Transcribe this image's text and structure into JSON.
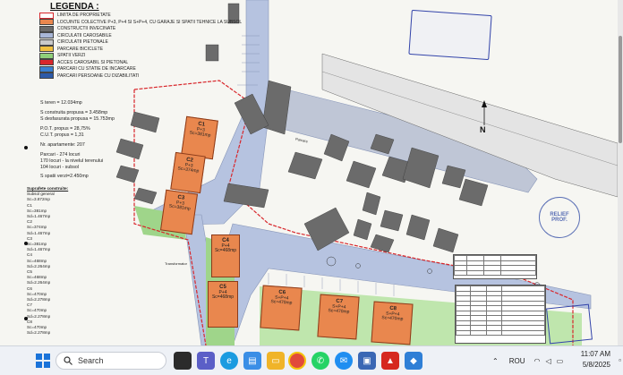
{
  "legend": {
    "title": "LEGENDA :",
    "items": [
      {
        "label": "LIMITA DE PROPRIETATE",
        "color": "#ffffff",
        "border": "#d8262b"
      },
      {
        "label": "LOCUINTE COLECTIVE P+3, P+4 SI S+P+4, CU GARAJE SI SPATII TEHNICE LA SUBSOL",
        "color": "#e9874e"
      },
      {
        "label": "CONSTRUCTII INVECINATE",
        "color": "#6b6b6b"
      },
      {
        "label": "CIRCULATII CAROSABILE",
        "color": "#a8b6d6"
      },
      {
        "label": "CIRCULATII PIETONALE",
        "color": "#c9c9c9"
      },
      {
        "label": "PARCARE BICICLETE",
        "color": "#f0c040"
      },
      {
        "label": "SPATII VERZI",
        "color": "#8fcf7a"
      },
      {
        "label": "ACCES CAROSABIL SI PIETONAL",
        "color": "#d8262b"
      },
      {
        "label": "PARCARI CU STATIE DE INCARCARE",
        "color": "#3a7fd0"
      },
      {
        "label": "PARCARI PERSOANE CU DIZABILITATI",
        "color": "#2d5aa8"
      }
    ]
  },
  "stats": {
    "teren": "S teren = 12.034mp",
    "construita": "S construita propusa = 3.458mp",
    "desfasurata": "S desfasurata propusa = 15.753mp",
    "pot": "P.O.T. propus = 28,75%",
    "cut": "C.U.T. propus = 1,31",
    "apartamente": "Nr. apartamente: 207",
    "parcari": "Parcari - 274 locuri",
    "parcari_teren": "170 locuri - la nivelul terenului",
    "parcari_subsol": "104 locuri - subsol",
    "spatii_verzi": "S spatii verzi=2.450mp"
  },
  "surfaces": {
    "title": "Suprafete construite:",
    "lines": [
      "Subsol general",
      "Sc=3.872mp",
      "C1",
      "Sc=381mp",
      "Sd=1.467mp",
      "C2",
      "Sc=374mp",
      "Sd=1.467mp",
      "C3",
      "Sc=381mp",
      "Sd=1.467mp",
      "C4",
      "Sc=468mp",
      "Sd=2.264mp",
      "C5",
      "Sc=468mp",
      "Sd=2.264mp",
      "C6",
      "Sc=470mp",
      "Sd=2.278mp",
      "C7",
      "Sc=470mp",
      "Sd=2.278mp",
      "C8",
      "Sc=470mp",
      "Sd=2.278mp"
    ]
  },
  "buildings": [
    {
      "id": "C1",
      "levels": "P+3",
      "area": "Sc=381mp"
    },
    {
      "id": "C2",
      "levels": "P+3",
      "area": "Sc=374mp"
    },
    {
      "id": "C3",
      "levels": "P+3",
      "area": "Sc=381mp"
    },
    {
      "id": "C4",
      "levels": "P+4",
      "area": "Sc=468mp"
    },
    {
      "id": "C5",
      "levels": "P+4",
      "area": "Sc=468mp"
    },
    {
      "id": "C6",
      "levels": "S+P+4",
      "area": "Sc=470mp"
    },
    {
      "id": "C7",
      "levels": "S+P+4",
      "area": "Sc=470mp"
    },
    {
      "id": "C8",
      "levels": "S+P+4",
      "area": "Sc=470mp"
    }
  ],
  "map_labels": {
    "north": "N",
    "stamp_relief": "RELIEF",
    "stamp_prof": "PROF.",
    "parking_label": "Parcare",
    "transformator": "Transformator"
  },
  "taskbar": {
    "search_placeholder": "Search",
    "language": "ROU",
    "time": "11:07 AM",
    "date": "5/8/2025"
  }
}
